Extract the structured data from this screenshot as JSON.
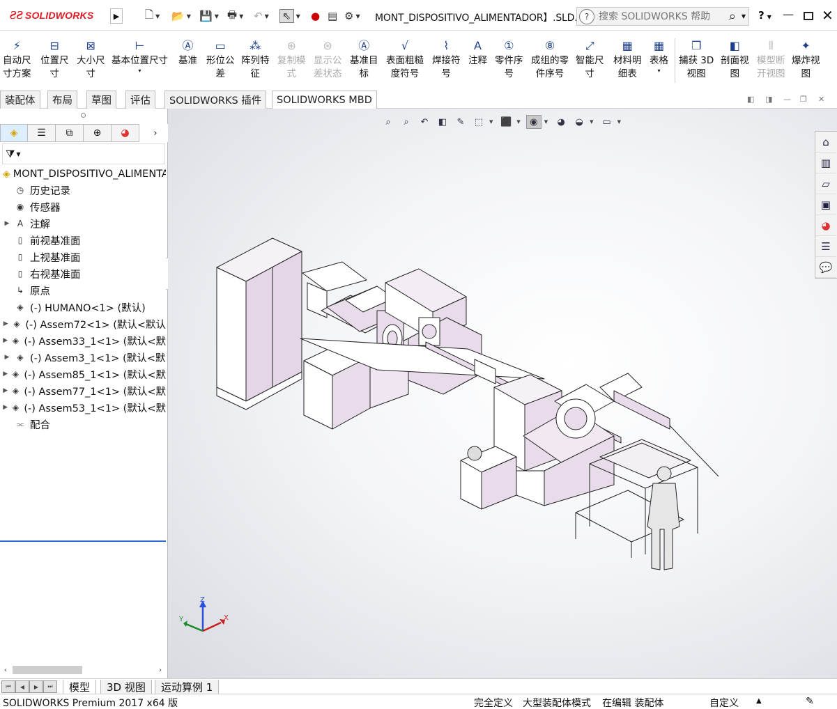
{
  "app": {
    "logo_text": "SOLIDWORKS",
    "document_title": "MONT_DISPOSITIVO_ALIMENTADOR】.SLD...",
    "search_placeholder": "搜索 SOLIDWORKS 帮助",
    "help_label": "?"
  },
  "ribbon": {
    "items": [
      {
        "label1": "自动尺",
        "label2": "寸方案",
        "icon": "auto-dimension-icon",
        "enabled": true
      },
      {
        "label1": "位置尺",
        "label2": "寸",
        "icon": "location-dimension-icon",
        "enabled": true
      },
      {
        "label1": "大小尺",
        "label2": "寸",
        "icon": "size-dimension-icon",
        "enabled": true
      },
      {
        "label1": "基本位置尺寸",
        "label2": "",
        "icon": "basic-location-dimension-icon",
        "enabled": true
      },
      {
        "label1": "基准",
        "label2": "",
        "icon": "datum-icon",
        "enabled": true
      },
      {
        "label1": "形位公",
        "label2": "差",
        "icon": "geometric-tolerance-icon",
        "enabled": true
      },
      {
        "label1": "阵列特",
        "label2": "征",
        "icon": "pattern-feature-icon",
        "enabled": true
      },
      {
        "label1": "复制模",
        "label2": "式",
        "icon": "copy-scheme-icon",
        "enabled": false
      },
      {
        "label1": "显示公",
        "label2": "差状态",
        "icon": "show-tolerance-status-icon",
        "enabled": false
      },
      {
        "label1": "基准目",
        "label2": "标",
        "icon": "datum-target-icon",
        "enabled": true
      },
      {
        "label1": "表面粗糙",
        "label2": "度符号",
        "icon": "surface-finish-icon",
        "enabled": true
      },
      {
        "label1": "焊接符",
        "label2": "号",
        "icon": "weld-symbol-icon",
        "enabled": true
      },
      {
        "label1": "注释",
        "label2": "",
        "icon": "note-icon",
        "enabled": true
      },
      {
        "label1": "零件序",
        "label2": "号",
        "icon": "balloon-icon",
        "enabled": true
      },
      {
        "label1": "成组的零",
        "label2": "件序号",
        "icon": "stacked-balloon-icon",
        "enabled": true
      },
      {
        "label1": "智能尺",
        "label2": "寸",
        "icon": "smart-dimension-icon",
        "enabled": true
      },
      {
        "label1": "材料明",
        "label2": "细表",
        "icon": "bom-icon",
        "enabled": true
      },
      {
        "label1": "表格",
        "label2": "",
        "icon": "table-icon",
        "enabled": true
      },
      {
        "label1": "捕获 3D",
        "label2": "视图",
        "icon": "capture-3d-view-icon",
        "enabled": true
      },
      {
        "label1": "剖面视",
        "label2": "图",
        "icon": "section-view-icon",
        "enabled": true
      },
      {
        "label1": "模型断",
        "label2": "开视图",
        "icon": "model-break-view-icon",
        "enabled": false
      },
      {
        "label1": "爆炸视",
        "label2": "图",
        "icon": "exploded-view-icon",
        "enabled": true
      }
    ]
  },
  "tabs": [
    "装配体",
    "布局",
    "草图",
    "评估",
    "SOLIDWORKS 插件",
    "SOLIDWORKS MBD"
  ],
  "active_tab": "SOLIDWORKS MBD",
  "tree": {
    "root": "MONT_DISPOSITIVO_ALIMENTADOR",
    "items": [
      {
        "label": "历史记录",
        "expandable": false,
        "icon": "history-icon"
      },
      {
        "label": "传感器",
        "expandable": false,
        "icon": "sensor-icon"
      },
      {
        "label": "注解",
        "expandable": true,
        "icon": "annotation-icon"
      },
      {
        "label": "前视基准面",
        "expandable": false,
        "icon": "plane-icon"
      },
      {
        "label": "上视基准面",
        "expandable": false,
        "icon": "plane-icon"
      },
      {
        "label": "右视基准面",
        "expandable": false,
        "icon": "plane-icon"
      },
      {
        "label": "原点",
        "expandable": false,
        "icon": "origin-icon"
      },
      {
        "label": "(-) HUMANO<1> (默认)",
        "expandable": false,
        "icon": "assembly-icon"
      },
      {
        "label": "(-) Assem72<1> (默认<默认",
        "expandable": true,
        "icon": "assembly-icon"
      },
      {
        "label": "(-) Assem33_1<1> (默认<默",
        "expandable": true,
        "icon": "assembly-icon"
      },
      {
        "label": "(-) Assem3_1<1> (默认<默",
        "expandable": true,
        "icon": "assembly-icon"
      },
      {
        "label": "(-) Assem85_1<1> (默认<默",
        "expandable": true,
        "icon": "assembly-icon"
      },
      {
        "label": "(-) Assem77_1<1> (默认<默",
        "expandable": true,
        "icon": "assembly-icon"
      },
      {
        "label": "(-) Assem53_1<1> (默认<默",
        "expandable": true,
        "icon": "assembly-icon"
      },
      {
        "label": "配合",
        "expandable": false,
        "icon": "mates-icon"
      }
    ]
  },
  "triad": {
    "x": "X",
    "y": "Y",
    "z": "Z"
  },
  "bottom_tabs": [
    "模型",
    "3D 视图",
    "运动算例 1"
  ],
  "active_bottom_tab": "模型",
  "status": {
    "version": "SOLIDWORKS Premium 2017 x64 版",
    "definition": "完全定义",
    "mode": "大型装配体模式",
    "editing": "在编辑 装配体",
    "units": "自定义"
  },
  "colors": {
    "brand_red": "#e21a22",
    "part_fill": "#e8dcea",
    "selection_blue": "#2a6fd6"
  }
}
